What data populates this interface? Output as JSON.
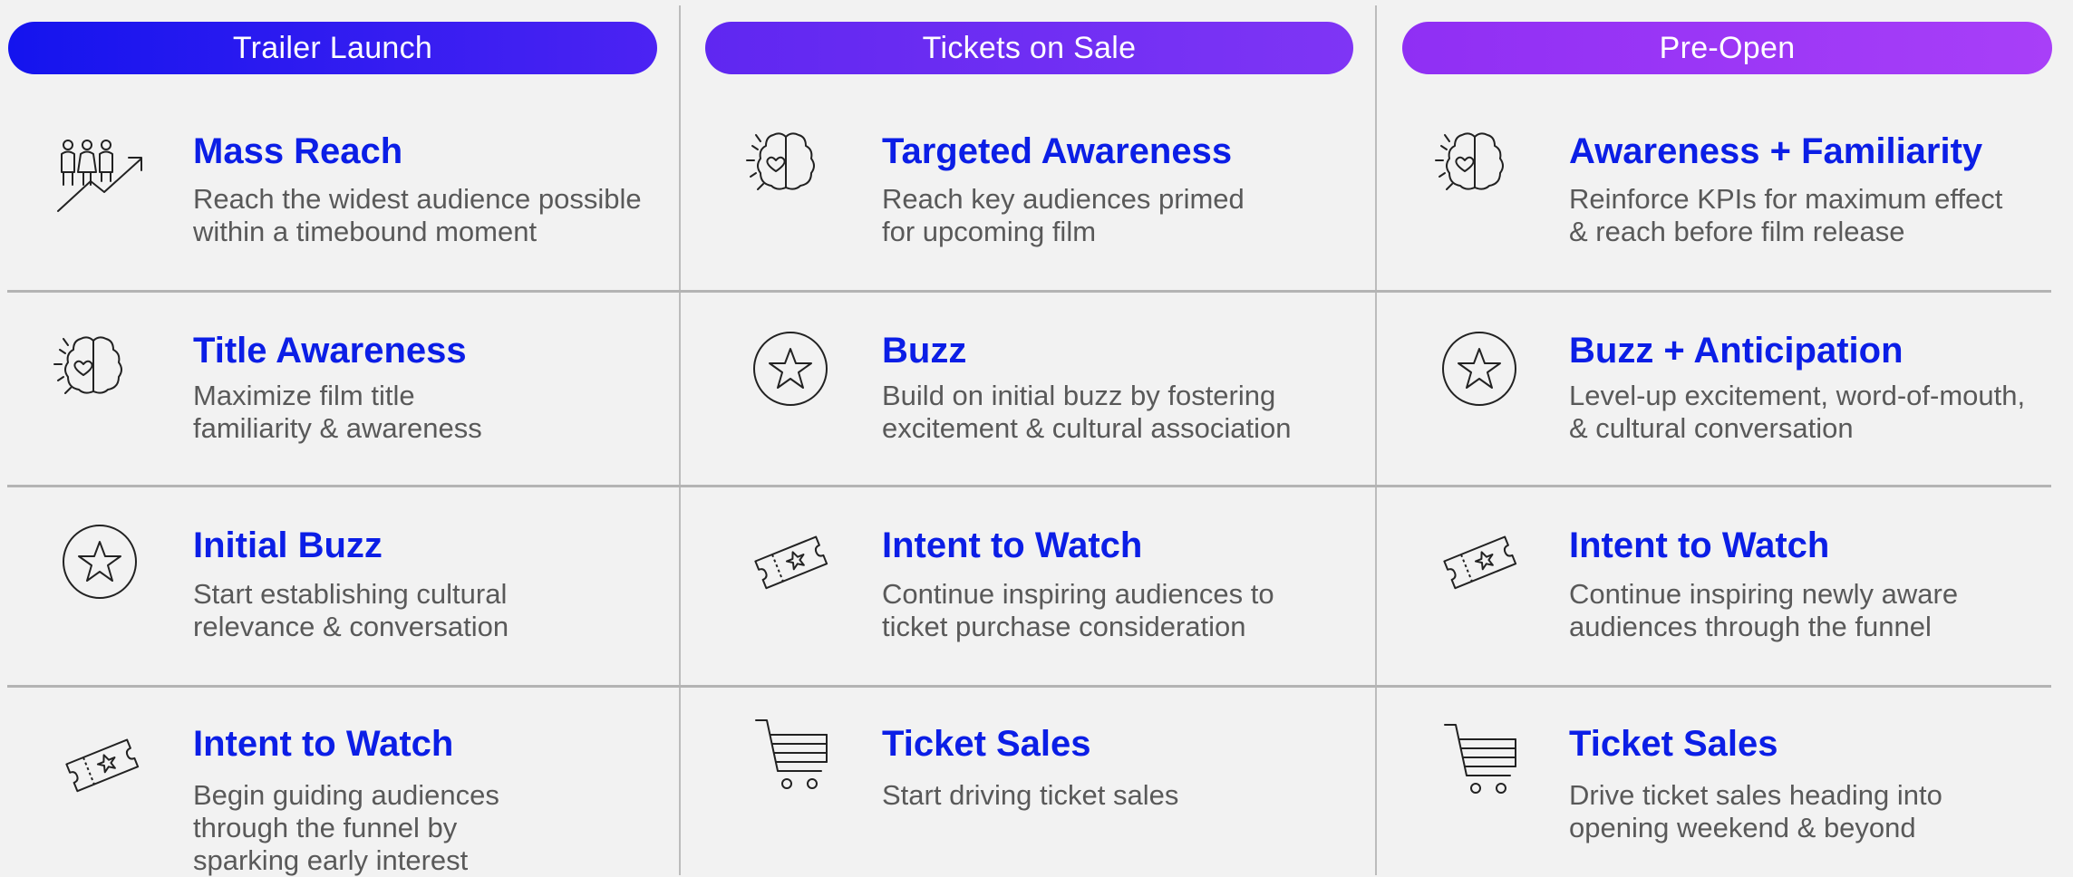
{
  "phases": [
    {
      "label": "Trailer Launch",
      "gradient": [
        "#1919ee",
        "#4a22f2"
      ]
    },
    {
      "label": "Tickets on Sale",
      "gradient": [
        "#6a2bf2",
        "#7a34f5"
      ]
    },
    {
      "label": "Pre-Open",
      "gradient": [
        "#9532f5",
        "#a63ff7"
      ]
    }
  ],
  "colors": {
    "title": "#0b1ee6",
    "text": "#595959",
    "icon": "#222222"
  },
  "grid": [
    [
      {
        "icon": "people-growth-icon",
        "title": "Mass Reach",
        "desc": "Reach the widest audience possible\nwithin a timebound moment"
      },
      {
        "icon": "brain-heart-icon",
        "title": "Title Awareness",
        "desc": "Maximize film title\nfamiliarity & awareness"
      },
      {
        "icon": "star-circle-icon",
        "title": "Initial Buzz",
        "desc": "Start establishing cultural\nrelevance & conversation"
      },
      {
        "icon": "ticket-icon",
        "title": "Intent to Watch",
        "desc": "Begin guiding audiences\nthrough the funnel by\nsparking early interest"
      }
    ],
    [
      {
        "icon": "brain-heart-icon",
        "title": "Targeted Awareness",
        "desc": "Reach key audiences primed\nfor upcoming film"
      },
      {
        "icon": "star-circle-icon",
        "title": "Buzz",
        "desc": "Build on initial buzz by fostering\nexcitement & cultural association"
      },
      {
        "icon": "ticket-icon",
        "title": "Intent to Watch",
        "desc": "Continue inspiring audiences to\nticket purchase consideration"
      },
      {
        "icon": "shopping-cart-icon",
        "title": "Ticket Sales",
        "desc": "Start driving ticket sales"
      }
    ],
    [
      {
        "icon": "brain-heart-icon",
        "title": "Awareness + Familiarity",
        "desc": "Reinforce KPIs for maximum effect\n& reach before film release"
      },
      {
        "icon": "star-circle-icon",
        "title": "Buzz + Anticipation",
        "desc": "Level-up excitement, word-of-mouth,\n& cultural conversation"
      },
      {
        "icon": "ticket-icon",
        "title": "Intent to Watch",
        "desc": "Continue inspiring newly aware\naudiences through the funnel"
      },
      {
        "icon": "shopping-cart-icon",
        "title": "Ticket Sales",
        "desc": "Drive ticket sales heading into\nopening weekend & beyond"
      }
    ]
  ]
}
